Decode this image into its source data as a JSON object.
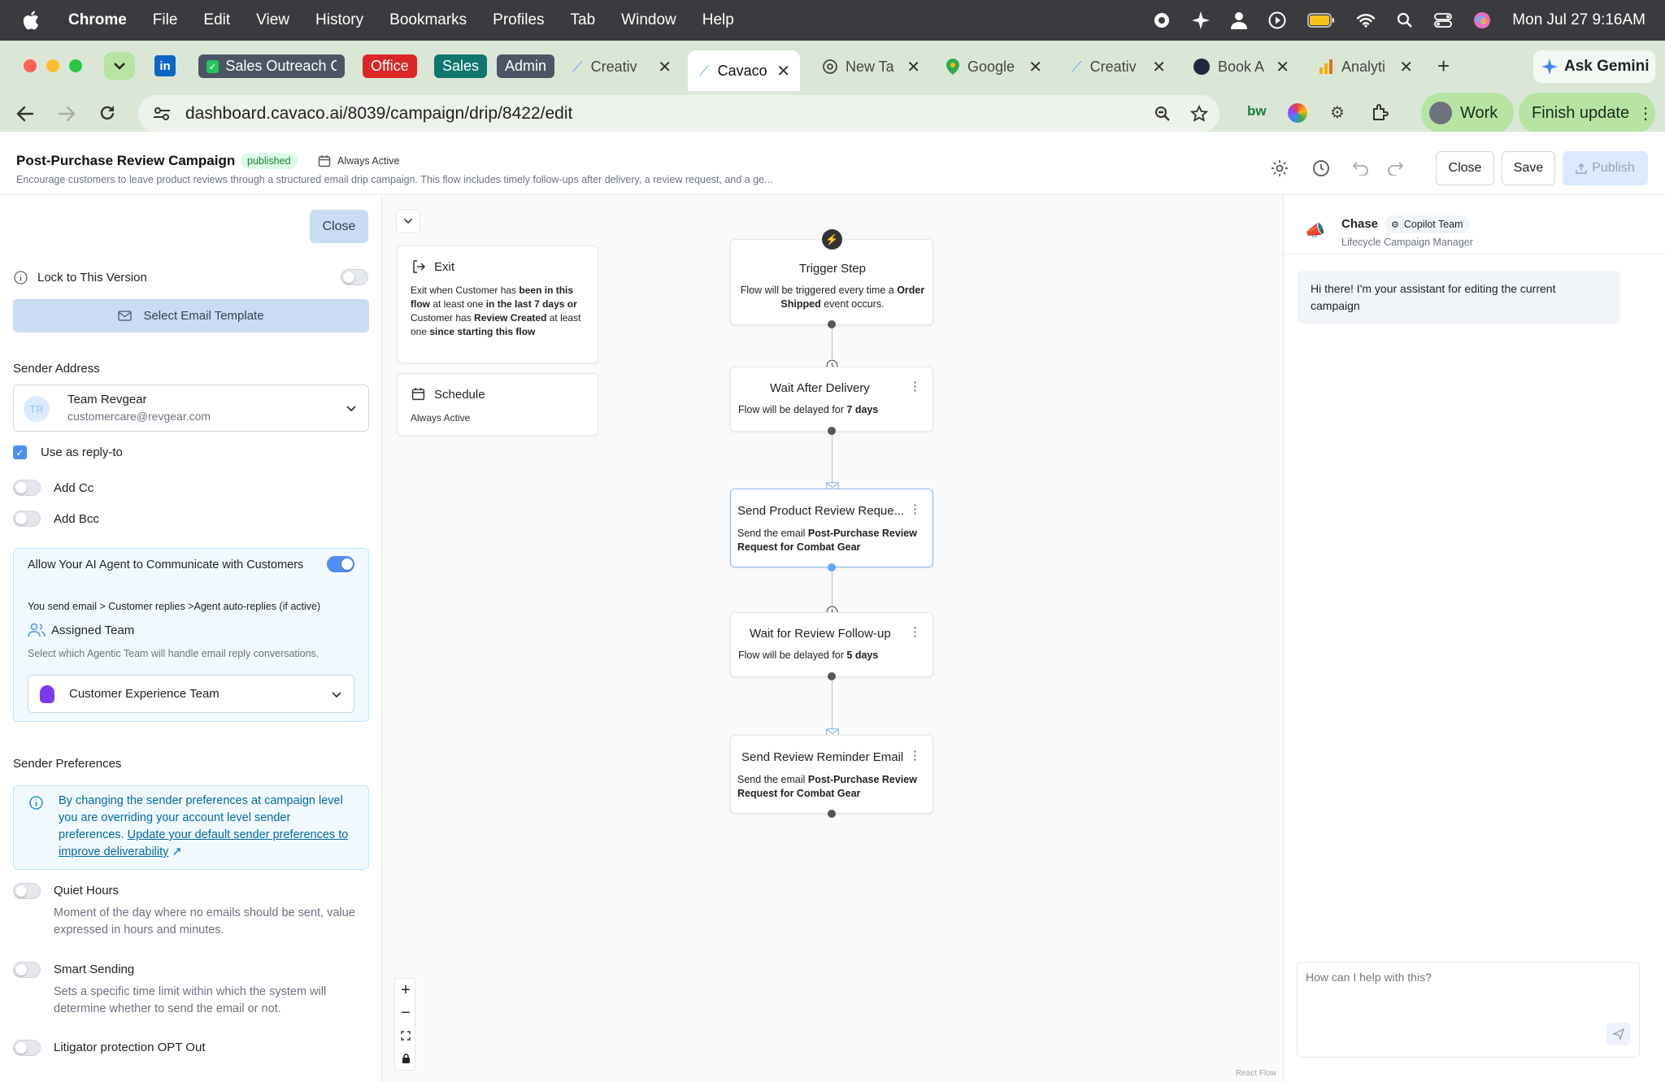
{
  "menubar": {
    "app": "Chrome",
    "items": [
      "File",
      "Edit",
      "View",
      "History",
      "Bookmarks",
      "Profiles",
      "Tab",
      "Window",
      "Help"
    ],
    "datetime": "Mon Jul 27  9:16AM"
  },
  "tabs": {
    "groups": [
      {
        "label": "Sales Outreach C",
        "color": "#4b5563"
      },
      {
        "label": "Office",
        "color": "#dc2626"
      },
      {
        "label": "Sales",
        "color": "#0f766e"
      },
      {
        "label": "Admin",
        "color": "#4b5563"
      }
    ],
    "items": [
      {
        "label": "Creativ"
      },
      {
        "label": "Cavaco",
        "active": true
      },
      {
        "label": "New Ta"
      },
      {
        "label": "Google"
      },
      {
        "label": "Creativ"
      },
      {
        "label": "Book A"
      },
      {
        "label": "Analyti"
      }
    ],
    "ask_gemini": "Ask Gemini"
  },
  "toolbar": {
    "url": "dashboard.cavaco.ai/8039/campaign/drip/8422/edit",
    "profile": "Work",
    "finish_update": "Finish update"
  },
  "header": {
    "title": "Post-Purchase Review Campaign",
    "status": "published",
    "schedule": "Always Active",
    "description": "Encourage customers to leave product reviews through a structured email drip campaign. This flow includes timely follow-ups after delivery, a review request, and a ge...",
    "close": "Close",
    "save": "Save",
    "publish": "Publish"
  },
  "left": {
    "close": "Close",
    "lock_label": "Lock to This Version",
    "select_template": "Select Email Template",
    "sender_address_title": "Sender Address",
    "sender": {
      "initials": "TR",
      "name": "Team Revgear",
      "email": "customercare@revgear.com"
    },
    "use_reply_to": "Use as reply-to",
    "add_cc": "Add Cc",
    "add_bcc": "Add Bcc",
    "ai": {
      "title": "Allow Your AI Agent to Communicate with Customers",
      "flow": "You send email > Customer replies >Agent auto-replies (if active)",
      "assigned_team": "Assigned Team",
      "assigned_desc": "Select which Agentic Team will handle email reply conversations.",
      "team": "Customer Experience Team"
    },
    "prefs_title": "Sender Preferences",
    "prefs_note": "By changing the sender preferences at campaign level you are overriding your account level sender preferences.",
    "prefs_link": "Update your default sender preferences to improve deliverability",
    "quiet_hours": "Quiet Hours",
    "quiet_desc": "Moment of the day where no emails should be sent, value expressed in hours and minutes.",
    "smart_sending": "Smart Sending",
    "smart_desc": "Sets a specific time limit within which the system will determine whether to send the email or not.",
    "litigator": "Litigator protection OPT Out"
  },
  "canvas": {
    "exit": {
      "title": "Exit",
      "p1": "Exit when Customer has ",
      "b1": "been in this flow",
      "p2": " at least one ",
      "b2": "in the last 7 days or",
      "p3": " Customer has ",
      "b3": "Review Created",
      "p4": " at least one ",
      "b4": "since starting this flow"
    },
    "schedule": {
      "title": "Schedule",
      "value": "Always Active"
    },
    "nodes": {
      "trigger": {
        "title": "Trigger Step",
        "p1": "Flow will be triggered every time a ",
        "b1": "Order Shipped",
        "p2": " event occurs."
      },
      "wait1": {
        "title": "Wait After Delivery",
        "p1": "Flow will be delayed for ",
        "b1": "7 days"
      },
      "email1": {
        "title": "Send Product Review Reque...",
        "p1": "Send the email ",
        "b1": "Post-Purchase Review Request for Combat Gear"
      },
      "wait2": {
        "title": "Wait for Review Follow-up",
        "p1": "Flow will be delayed for ",
        "b1": "5 days"
      },
      "email2": {
        "title": "Send Review Reminder Email",
        "p1": "Send the email ",
        "b1": "Post-Purchase Review Request for Combat Gear"
      }
    },
    "attribution": "React Flow"
  },
  "chat": {
    "name": "Chase",
    "team": "Copilot Team",
    "role": "Lifecycle Campaign Manager",
    "greeting": "Hi there! I'm your assistant for editing the current campaign",
    "placeholder": "How can I help with this?"
  }
}
